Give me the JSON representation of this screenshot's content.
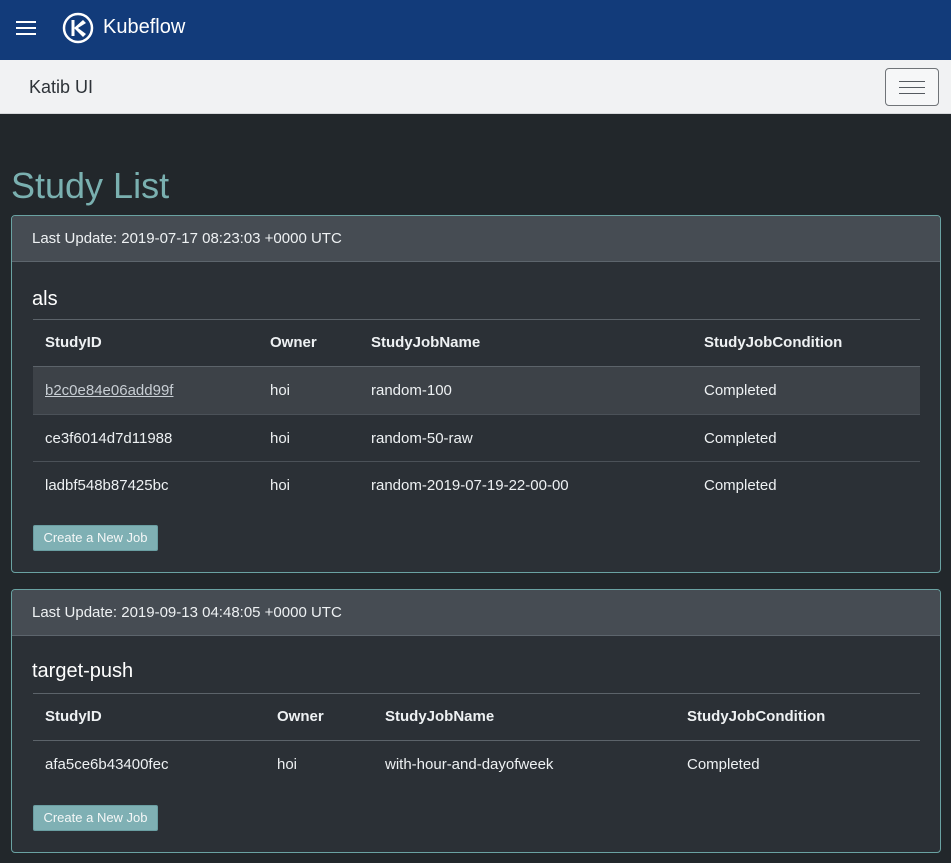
{
  "app": {
    "name": "Kubeflow",
    "colors": {
      "topbar": "#123b7a",
      "accent": "#7ab0b0",
      "card_border": "#6aa2a2"
    }
  },
  "subnav": {
    "title": "Katib UI",
    "toggle_icon": "menu-icon"
  },
  "page": {
    "title": "Study List"
  },
  "studies": [
    {
      "last_update": "Last Update: 2019-07-17 08:23:03 +0000 UTC",
      "name": "als",
      "columns": [
        "StudyID",
        "Owner",
        "StudyJobName",
        "StudyJobCondition"
      ],
      "rows": [
        {
          "id": "b2c0e84e06add99f",
          "owner": "hoi",
          "job_name": "random-100",
          "condition": "Completed"
        },
        {
          "id": "ce3f6014d7d11988",
          "owner": "hoi",
          "job_name": "random-50-raw",
          "condition": "Completed"
        },
        {
          "id": "ladbf548b87425bc",
          "owner": "hoi",
          "job_name": "random-2019-07-19-22-00-00",
          "condition": "Completed"
        }
      ],
      "button": "Create a New Job"
    },
    {
      "last_update": "Last Update: 2019-09-13 04:48:05 +0000 UTC",
      "name": "target-push",
      "columns": [
        "StudyID",
        "Owner",
        "StudyJobName",
        "StudyJobCondition"
      ],
      "rows": [
        {
          "id": "afa5ce6b43400fec",
          "owner": "hoi",
          "job_name": "with-hour-and-dayofweek",
          "condition": "Completed"
        }
      ],
      "button": "Create a New Job"
    }
  ]
}
